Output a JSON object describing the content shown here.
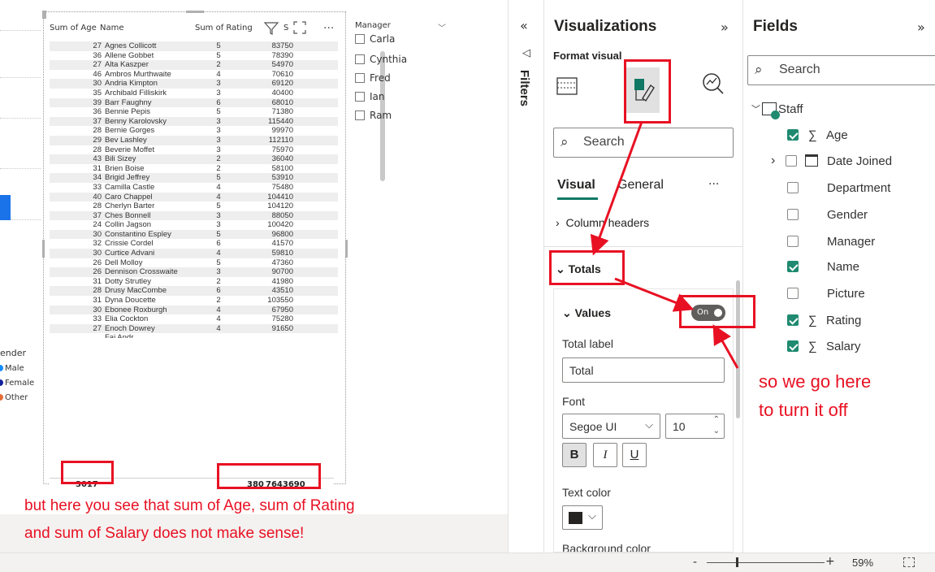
{
  "canvas": {
    "legend": {
      "title": "ender",
      "items": [
        {
          "label": "Male",
          "color": "#118dff"
        },
        {
          "label": "Female",
          "color": "#12239e"
        },
        {
          "label": "Other",
          "color": "#e66c37"
        }
      ]
    },
    "table": {
      "headers": {
        "age": "Sum of Age",
        "name": "Name",
        "rating": "Sum of Rating",
        "salary": "S"
      },
      "rows": [
        [
          "27",
          "Agnes Collicott",
          "5",
          "83750"
        ],
        [
          "36",
          "Allene Gobbet",
          "5",
          "78390"
        ],
        [
          "27",
          "Alta Kaszper",
          "2",
          "54970"
        ],
        [
          "46",
          "Ambros Murthwaite",
          "4",
          "70610"
        ],
        [
          "30",
          "Andria Kimpton",
          "3",
          "69120"
        ],
        [
          "35",
          "Archibald Filliskirk",
          "3",
          "40400"
        ],
        [
          "39",
          "Barr Faughny",
          "6",
          "68010"
        ],
        [
          "36",
          "Bennie Pepis",
          "5",
          "71380"
        ],
        [
          "37",
          "Benny Karolovsky",
          "3",
          "115440"
        ],
        [
          "28",
          "Bernie Gorges",
          "3",
          "99970"
        ],
        [
          "29",
          "Bev Lashley",
          "3",
          "112110"
        ],
        [
          "28",
          "Beverie Moffet",
          "3",
          "75970"
        ],
        [
          "43",
          "Bili Sizey",
          "2",
          "36040"
        ],
        [
          "31",
          "Brien Boise",
          "2",
          "58100"
        ],
        [
          "34",
          "Brigid Jeffrey",
          "5",
          "53910"
        ],
        [
          "33",
          "Camilla Castle",
          "4",
          "75480"
        ],
        [
          "40",
          "Caro Chappel",
          "4",
          "104410"
        ],
        [
          "28",
          "Cherlyn Barter",
          "5",
          "104120"
        ],
        [
          "37",
          "Ches Bonnell",
          "3",
          "88050"
        ],
        [
          "24",
          "Collin Jagson",
          "3",
          "100420"
        ],
        [
          "30",
          "Constantino Espley",
          "5",
          "96800"
        ],
        [
          "32",
          "Crissie Cordel",
          "6",
          "41570"
        ],
        [
          "30",
          "Curtice Advani",
          "4",
          "59810"
        ],
        [
          "26",
          "Dell Molloy",
          "5",
          "47360"
        ],
        [
          "26",
          "Dennison Crosswaite",
          "3",
          "90700"
        ],
        [
          "31",
          "Dotty Strutley",
          "2",
          "41980"
        ],
        [
          "28",
          "Drusy MacCombe",
          "6",
          "43510"
        ],
        [
          "31",
          "Dyna Doucette",
          "2",
          "103550"
        ],
        [
          "30",
          "Ebonee Roxburgh",
          "4",
          "67950"
        ],
        [
          "33",
          "Elia Cockton",
          "4",
          "75280"
        ],
        [
          "27",
          "Enoch Dowrey",
          "4",
          "91650"
        ]
      ],
      "partial_row": "Fai Andr",
      "totals": {
        "age": "3017",
        "rating": "380",
        "salary": "7643690"
      }
    },
    "slicer": {
      "title": "Manager",
      "items": [
        "Carla",
        "Cynthia",
        "Fred",
        "Ian",
        "Ram"
      ]
    },
    "annotation_bottom": {
      "line1": "but here you see that sum of Age, sum of Rating",
      "line2": "and sum of Salary does not make sense!"
    }
  },
  "filters": {
    "label": "Filters"
  },
  "visualizations": {
    "title": "Visualizations",
    "format_visual": "Format visual",
    "search_placeholder": "Search",
    "tabs": [
      "Visual",
      "General"
    ],
    "sections": {
      "column_headers": "Column headers",
      "totals": "Totals",
      "values": "Values"
    },
    "toggle": "On",
    "total_label_caption": "Total label",
    "total_label_value": "Total",
    "font_caption": "Font",
    "font_family": "Segoe UI",
    "font_size": "10",
    "bold": "B",
    "italic": "I",
    "underline": "U",
    "text_color": "Text color",
    "background_color": "Background color",
    "annotation": {
      "line1": "so we go here",
      "line2": "to turn it off"
    }
  },
  "fields": {
    "title": "Fields",
    "search_placeholder": "Search",
    "table_name": "Staff",
    "items": [
      {
        "label": "Age",
        "checked": true,
        "sigma": true
      },
      {
        "label": "Date Joined",
        "checked": false,
        "calendar": true
      },
      {
        "label": "Department",
        "checked": false
      },
      {
        "label": "Gender",
        "checked": false
      },
      {
        "label": "Manager",
        "checked": false
      },
      {
        "label": "Name",
        "checked": true
      },
      {
        "label": "Picture",
        "checked": false
      },
      {
        "label": "Rating",
        "checked": true,
        "sigma": true
      },
      {
        "label": "Salary",
        "checked": true,
        "sigma": true
      }
    ]
  },
  "statusbar": {
    "zoom": "59%"
  }
}
